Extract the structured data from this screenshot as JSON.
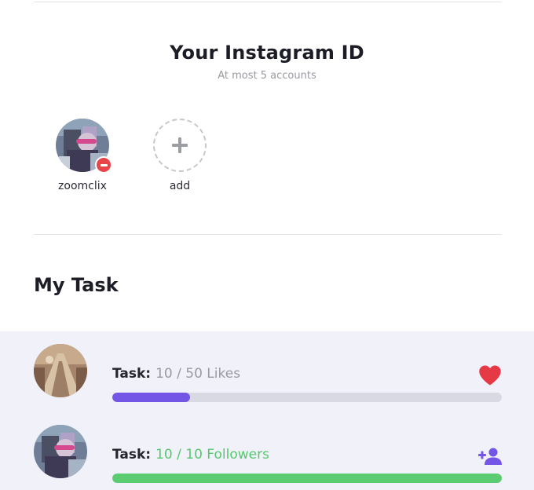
{
  "accounts_section": {
    "title": "Your Instagram ID",
    "subtitle": "At most 5 accounts",
    "accounts": [
      {
        "username": "zoomclix"
      }
    ],
    "add_label": "add"
  },
  "tasks_section": {
    "title": "My Task",
    "tasks": [
      {
        "label": "Task:",
        "value": "10 / 50 Likes",
        "progress": 0.2,
        "icon": "heart-icon",
        "color": "#7456e6",
        "icon_color": "#e63946"
      },
      {
        "label": "Task:",
        "value": "10 / 10 Followers",
        "progress": 1.0,
        "icon": "add-user-icon",
        "color": "#5bcc71",
        "icon_color": "#7456e6"
      }
    ]
  }
}
